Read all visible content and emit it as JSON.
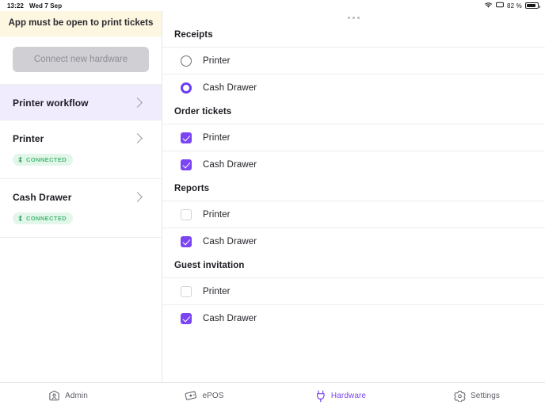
{
  "status_bar": {
    "time": "13:22",
    "date": "Wed 7 Sep",
    "battery_percent": "82 %",
    "wifi_icon": "wifi-icon",
    "battery_icon": "battery-icon"
  },
  "sidebar": {
    "banner": "App must be open to print tickets",
    "connect_button": "Connect new hardware",
    "items": [
      {
        "title": "Printer workflow",
        "active": true,
        "badge": null
      },
      {
        "title": "Printer",
        "active": false,
        "badge": "CONNECTED"
      },
      {
        "title": "Cash Drawer",
        "active": false,
        "badge": "CONNECTED"
      }
    ]
  },
  "main": {
    "grabber": "drag-handle",
    "sections": [
      {
        "title": "Receipts",
        "control": "radio",
        "options": [
          {
            "label": "Printer",
            "selected": false
          },
          {
            "label": "Cash Drawer",
            "selected": true
          }
        ]
      },
      {
        "title": "Order tickets",
        "control": "checkbox",
        "options": [
          {
            "label": "Printer",
            "selected": true
          },
          {
            "label": "Cash Drawer",
            "selected": true
          }
        ]
      },
      {
        "title": "Reports",
        "control": "checkbox",
        "options": [
          {
            "label": "Printer",
            "selected": false
          },
          {
            "label": "Cash Drawer",
            "selected": true
          }
        ]
      },
      {
        "title": "Guest invitation",
        "control": "checkbox",
        "options": [
          {
            "label": "Printer",
            "selected": false
          },
          {
            "label": "Cash Drawer",
            "selected": true
          }
        ]
      }
    ]
  },
  "tabbar": {
    "tabs": [
      {
        "label": "Admin",
        "icon": "admin-person-icon",
        "active": false
      },
      {
        "label": "ePOS",
        "icon": "epos-card-icon",
        "active": false
      },
      {
        "label": "Hardware",
        "icon": "plug-icon",
        "active": true
      },
      {
        "label": "Settings",
        "icon": "gear-icon",
        "active": false
      }
    ]
  },
  "colors": {
    "accent": "#7b45f3",
    "accent_soft": "#f1ecfd",
    "banner_bg": "#fdf6e0",
    "badge_bg": "#e2f7e9",
    "badge_text": "#4ab878"
  }
}
